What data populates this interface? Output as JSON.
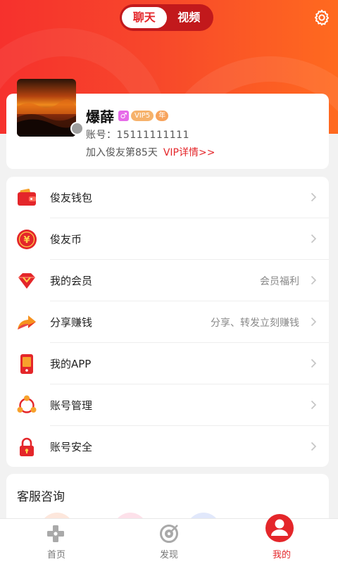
{
  "header": {
    "tabs": [
      {
        "label": "聊天",
        "active": true
      },
      {
        "label": "视频",
        "active": false
      }
    ],
    "settings_icon": "gear-icon"
  },
  "profile": {
    "nickname": "爆薛",
    "sex_symbol": "♂",
    "vip_badge": "VIP5",
    "year_badge": "年",
    "account": "账号：15111111111",
    "join_text": "加入俊友第85天",
    "vip_link": "VIP详情>>"
  },
  "menu": {
    "items": [
      {
        "label": "俊友钱包",
        "hint": "",
        "icon": "wallet-icon"
      },
      {
        "label": "俊友币",
        "hint": "",
        "icon": "coin-icon"
      },
      {
        "label": "我的会员",
        "hint": "会员福利",
        "icon": "diamond-icon"
      },
      {
        "label": "分享赚钱",
        "hint": "分享、转发立刻赚钱",
        "icon": "share-arrow-icon"
      },
      {
        "label": "我的APP",
        "hint": "",
        "icon": "phone-icon"
      },
      {
        "label": "账号管理",
        "hint": "",
        "icon": "account-manage-icon"
      },
      {
        "label": "账号安全",
        "hint": "",
        "icon": "lock-icon"
      }
    ]
  },
  "service": {
    "title": "客服咨询"
  },
  "tabbar": {
    "items": [
      {
        "label": "首页",
        "icon": "gamepad-icon",
        "active": false
      },
      {
        "label": "发现",
        "icon": "discover-icon",
        "active": false
      },
      {
        "label": "我的",
        "icon": "user-icon",
        "active": true
      }
    ]
  },
  "colors": {
    "brand_red": "#e4262a",
    "header_gradient_start": "#f6312d",
    "header_gradient_end": "#ff6a1f"
  }
}
